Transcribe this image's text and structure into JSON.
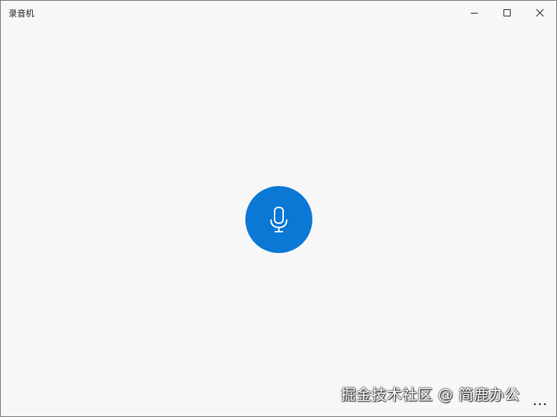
{
  "window": {
    "title": "录音机"
  },
  "controls": {
    "minimize_icon": "minimize-icon",
    "maximize_icon": "maximize-icon",
    "close_icon": "close-icon"
  },
  "main": {
    "record_icon": "microphone-icon",
    "accent_color": "#0a78d4"
  },
  "watermark": {
    "text": "掘金技术社区 @ 简鹿办公"
  },
  "more": {
    "icon": "more-dots-icon"
  }
}
